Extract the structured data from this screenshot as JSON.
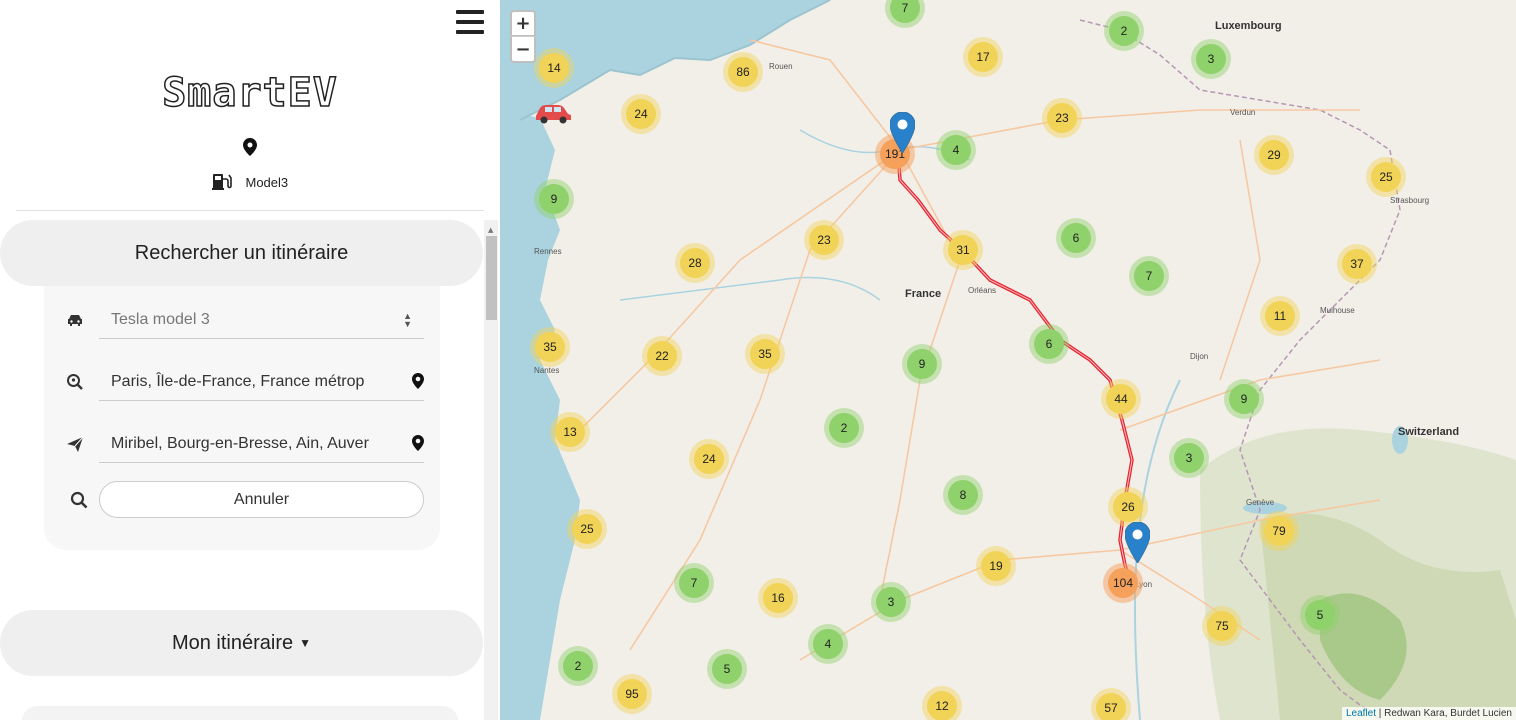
{
  "brand": {
    "logo_text": "SmartEV"
  },
  "vehicle": {
    "label": "Model3",
    "icon": "ev-charger-icon"
  },
  "search_section": {
    "title": "Rechercher un itinéraire",
    "car_select": {
      "value": "Tesla model 3",
      "icon": "car-icon"
    },
    "origin": {
      "value": "Paris, Île-de-France, France métrop",
      "icon": "search-location-icon"
    },
    "destination": {
      "value": "Miribel, Bourg-en-Bresse, Ain, Auver",
      "icon": "paper-plane-icon"
    },
    "cancel_label": "Annuler"
  },
  "itinerary_section": {
    "title": "Mon itinéraire"
  },
  "map": {
    "zoom_in": "+",
    "zoom_out": "−",
    "country_labels": [
      "France",
      "Switzerland",
      "Luxembourg"
    ],
    "attribution_link": "Leaflet",
    "attribution_text": "| Redwan Kara, Burdet Lucien",
    "clusters": [
      "7",
      "17",
      "2",
      "3",
      "14",
      "86",
      "24",
      "23",
      "191",
      "4",
      "29",
      "25",
      "9",
      "6",
      "7",
      "23",
      "28",
      "31",
      "37",
      "11",
      "35",
      "22",
      "35",
      "9",
      "6",
      "44",
      "9",
      "13",
      "2",
      "24",
      "3",
      "8",
      "26",
      "25",
      "79",
      "7",
      "16",
      "3",
      "19",
      "104",
      "75",
      "5",
      "2",
      "4",
      "5",
      "95",
      "12",
      "57"
    ],
    "colors": {
      "small": "#8fd16b",
      "medium": "#f1d357",
      "large": "#f5a05b",
      "route": "#e8232f",
      "marker": "#2a81cb",
      "water": "#aad3df"
    }
  }
}
